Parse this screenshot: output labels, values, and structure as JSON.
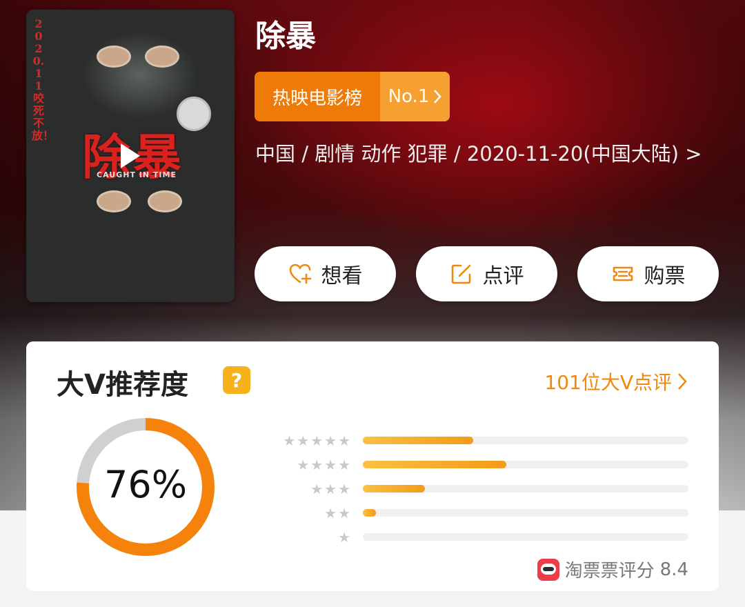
{
  "movie": {
    "title": "除暴",
    "rank_label": "热映电影榜",
    "rank_value": "No.1",
    "meta": "中国 / 剧情 动作 犯罪 / 2020-11-20(中国大陆) >",
    "poster": {
      "vertical_text": "2020.11 咬死不放！",
      "title": "除暴",
      "subtitle": "CAUGHT IN TIME"
    }
  },
  "actions": {
    "want_label": "想看",
    "review_label": "点评",
    "buy_label": "购票"
  },
  "rating_card": {
    "title": "大V推荐度",
    "help_symbol": "?",
    "reviews_link": "101位大V点评",
    "recommend_percent_text": "76%",
    "recommend_percent": 76,
    "distribution": [
      {
        "stars": 5,
        "fraction": 0.34
      },
      {
        "stars": 4,
        "fraction": 0.44
      },
      {
        "stars": 3,
        "fraction": 0.19
      },
      {
        "stars": 2,
        "fraction": 0.04
      },
      {
        "stars": 1,
        "fraction": 0.0
      }
    ],
    "score_source": "淘票票评分",
    "score": "8.4"
  },
  "colors": {
    "accent_orange": "#f2870e",
    "rank_orange": "#ee7a08",
    "donut_gray": "#d0d0d0"
  },
  "icons": [
    "play-icon",
    "heart-plus-icon",
    "edit-icon",
    "ticket-icon",
    "chevron-right-icon",
    "taopiaopiao-logo-icon"
  ]
}
